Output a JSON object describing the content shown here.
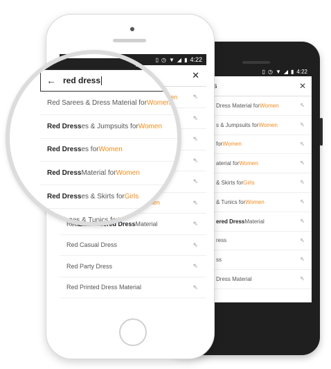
{
  "status": {
    "time": "4:22",
    "icons": [
      "vibrate-icon",
      "alarm-icon",
      "wifi-icon",
      "signal-icon",
      "battery-icon"
    ]
  },
  "search": {
    "query": "red dress"
  },
  "colors": {
    "accent": "#f08a1c",
    "statusbar": "#212121"
  },
  "suggestions": [
    {
      "pre": "",
      "bold": "",
      "mid": "Red Sarees & Dress Material for ",
      "accent": "Women"
    },
    {
      "pre": "",
      "bold": "Red Dress",
      "mid": "es & Jumpsuits for ",
      "accent": "Women"
    },
    {
      "pre": "",
      "bold": "Red Dress",
      "mid": "es for ",
      "accent": "Women"
    },
    {
      "pre": "",
      "bold": "Red Dress",
      "mid": " Material for ",
      "accent": "Women"
    },
    {
      "pre": "",
      "bold": "Red Dress",
      "mid": "es & Skirts for ",
      "accent": "Girls"
    },
    {
      "pre": "",
      "bold": "Red Dress",
      "mid": "es & Tunics for ",
      "accent": "Women"
    },
    {
      "pre": "Red ",
      "bold": "Embroidered Dress",
      "mid": " Material",
      "accent": ""
    },
    {
      "pre": "Red Casual Dress",
      "bold": "",
      "mid": "",
      "accent": ""
    },
    {
      "pre": "Red Party Dress",
      "bold": "",
      "mid": "",
      "accent": ""
    },
    {
      "pre": "Red Printed Dress Material",
      "bold": "",
      "mid": "",
      "accent": ""
    }
  ],
  "iphone_rows": [
    {
      "text": "Red Sarees & Dress Material for ",
      "accent": "Women"
    },
    {
      "text": "",
      "accent": ""
    },
    {
      "text": "",
      "accent": ""
    },
    {
      "text": "",
      "accent": ""
    },
    {
      "text": "",
      "accent": ""
    },
    {
      "text": "",
      "accent": ""
    },
    {
      "text": "Material",
      "accent": ""
    },
    {
      "text": "Red Casual Dress",
      "accent": ""
    },
    {
      "text": "Red Party Dress",
      "accent": ""
    },
    {
      "text": "Red Printed Dress Material",
      "accent": ""
    }
  ],
  "android_rows": [
    {
      "text": "Dress Material for ",
      "accent": "Women",
      "boldtext": ""
    },
    {
      "text": "s & Jumpsuits for ",
      "accent": "Women",
      "boldtext": ""
    },
    {
      "text": "for ",
      "accent": "Women",
      "boldtext": ""
    },
    {
      "text": "aterial for ",
      "accent": "Women",
      "boldtext": ""
    },
    {
      "text": " & Skirts for ",
      "accent": "Girls",
      "boldtext": ""
    },
    {
      "text": " & Tunics for ",
      "accent": "Women",
      "boldtext": ""
    },
    {
      "text": " Material",
      "accent": "",
      "boldtext": "ered Dress"
    },
    {
      "text": "ress",
      "accent": "",
      "boldtext": ""
    },
    {
      "text": "ss",
      "accent": "",
      "boldtext": ""
    },
    {
      "text": "Dress Material",
      "accent": "",
      "boldtext": ""
    }
  ],
  "android_search": {
    "query": "ess"
  },
  "lens_rows": [
    {
      "bold": "",
      "mid": "Red Sarees & Dress Material for ",
      "accent": "Women"
    },
    {
      "bold": "Red Dress",
      "mid": "es & Jumpsuits for ",
      "accent": "Women"
    },
    {
      "bold": "Red Dress",
      "mid": "es for ",
      "accent": "Women"
    },
    {
      "bold": "Red Dress",
      "mid": " Material for ",
      "accent": "Women"
    },
    {
      "bold": "Red Dress",
      "mid": "es & Skirts for ",
      "accent": "Girls"
    },
    {
      "bold": "d Dress",
      "mid": "es & Tunics for ",
      "accent": "Wom"
    }
  ]
}
